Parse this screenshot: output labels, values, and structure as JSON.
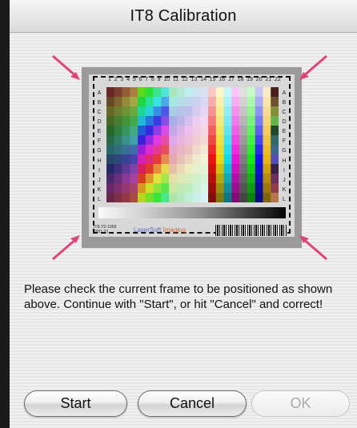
{
  "dialog": {
    "title": "IT8 Calibration",
    "message": "Please check the current frame to be positioned as shown above. Continue with \"Start\", or hit \"Cancel\" and correct!"
  },
  "target_image": {
    "column_numbers": [
      "1",
      "2",
      "3",
      "4",
      "5",
      "6",
      "7",
      "8",
      "9",
      "10",
      "11",
      "12",
      "13",
      "14",
      "15",
      "16",
      "17",
      "18",
      "19",
      "20",
      "21",
      "22"
    ],
    "row_letters": [
      "A",
      "B",
      "C",
      "D",
      "E",
      "F",
      "G",
      "H",
      "I",
      "J",
      "K",
      "L"
    ],
    "footer_id": "IT8.7/2-1993 2001:23",
    "logo_text": "LaserSoft",
    "logo_text2": "Imaging",
    "arrow_color": "#e0457a"
  },
  "buttons": {
    "start": "Start",
    "cancel": "Cancel",
    "ok": "OK"
  }
}
